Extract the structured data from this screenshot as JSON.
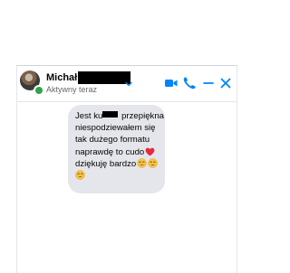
{
  "chat": {
    "contact_name": "Michał",
    "status": "Aktywny teraz",
    "icons": {
      "chevron": "chevron-down-icon",
      "video": "video-call-icon",
      "phone": "phone-call-icon",
      "minimize": "minimize-icon",
      "close": "close-icon"
    },
    "accent_color": "#0084ff",
    "online_color": "#31a24c"
  },
  "message": {
    "line1_start": "Jest ku",
    "line1_end": "przepiękna",
    "line2": "niespodziewałem się",
    "line3": "tak dużego formatu",
    "line4": "naprawdę to cudo",
    "line5": "dziękuję bardzo",
    "bubble_color": "#e4e6eb",
    "emoji": [
      "red-heart-emoji",
      "grinning-face-emoji",
      "grinning-face-emoji",
      "grinning-face-emoji"
    ]
  }
}
